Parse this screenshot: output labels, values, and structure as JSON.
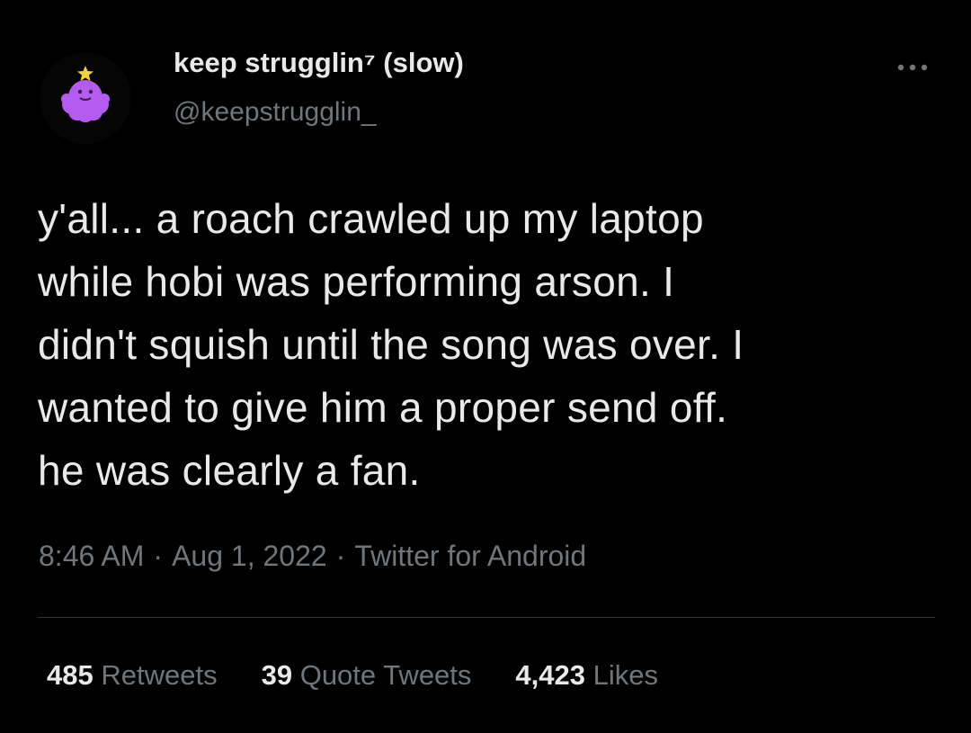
{
  "user": {
    "display_name": "keep strugglin⁷ (slow)",
    "handle": "@keepstrugglin_",
    "avatar_icon": "lumpy-space-princess-icon"
  },
  "more_icon": "more-options-icon",
  "tweet": {
    "text": "y'all... a roach crawled up my laptop\nwhile hobi was performing arson. I\ndidn't squish until the song was over. I\nwanted to give him a proper send off.\nhe was clearly a fan."
  },
  "meta": {
    "time": "8:46 AM",
    "separator": "·",
    "date": "Aug 1, 2022",
    "source": "Twitter for Android"
  },
  "stats": {
    "retweets": {
      "count": "485",
      "label": "Retweets"
    },
    "quotes": {
      "count": "39",
      "label": "Quote Tweets"
    },
    "likes": {
      "count": "4,423",
      "label": "Likes"
    }
  },
  "colors": {
    "background": "#000000",
    "primary_text": "#e7e9ea",
    "secondary_text": "#71767b",
    "divider": "#2f3336",
    "avatar_purple": "#b05ff0"
  }
}
